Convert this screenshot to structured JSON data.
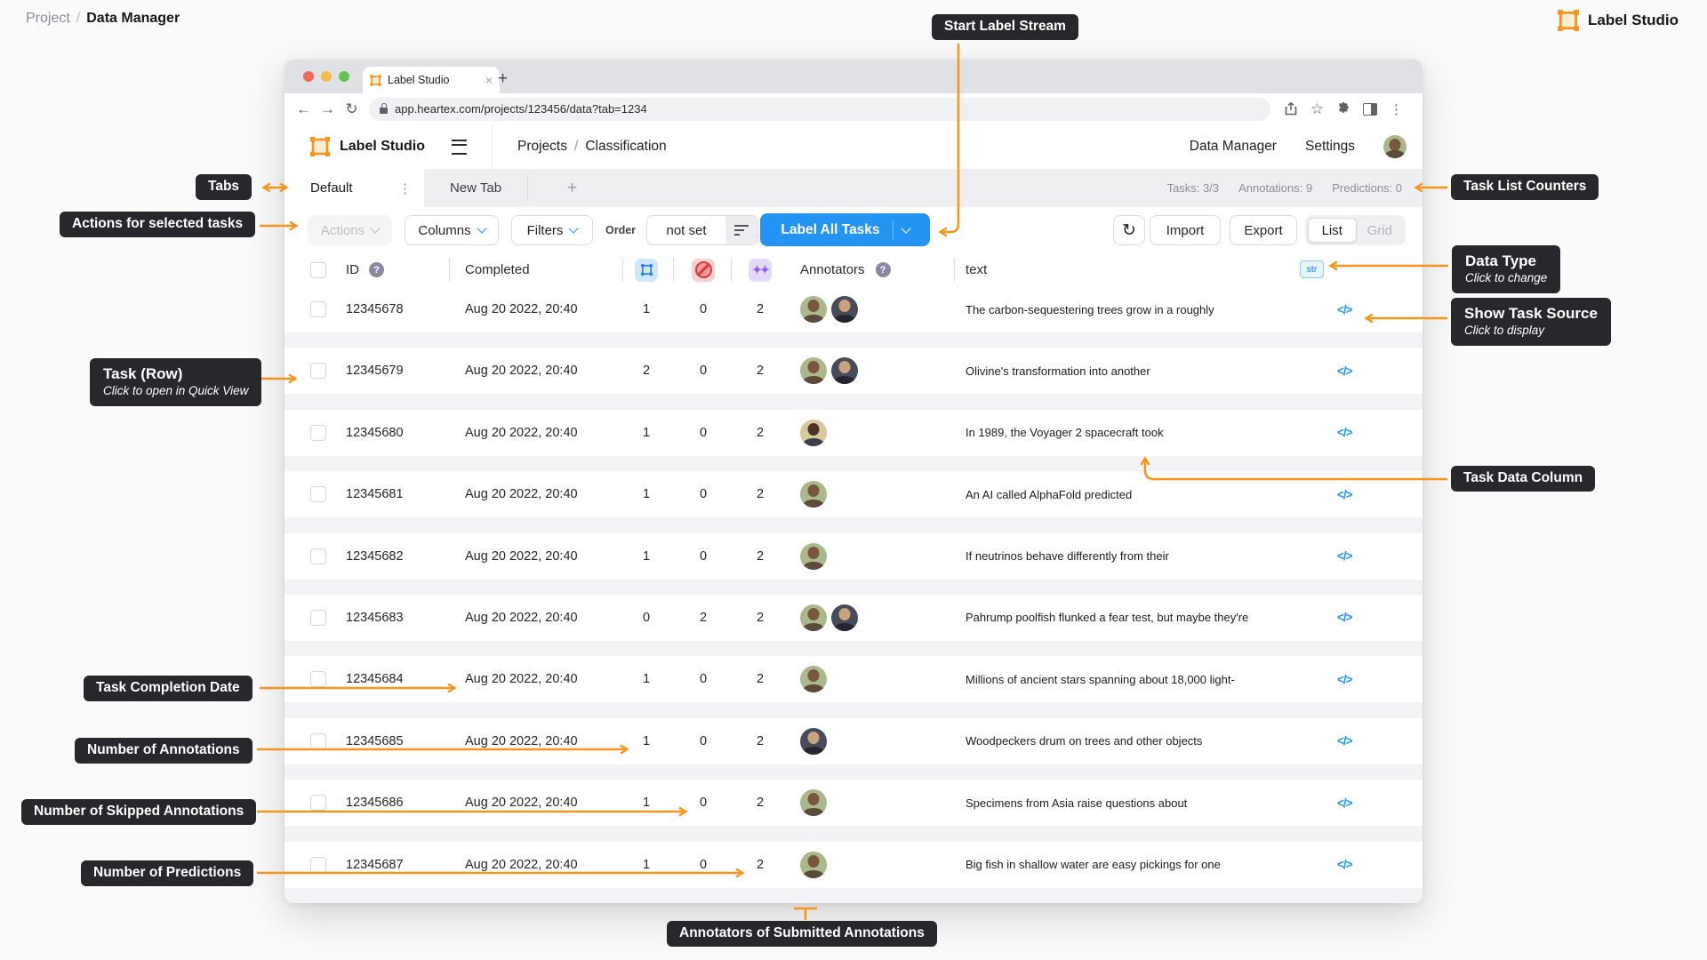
{
  "colors": {
    "accent_orange": "#F7941E",
    "primary_blue": "#2494F3",
    "link_blue": "#1890FF",
    "callout_bg": "#28282C"
  },
  "breadcrumb": {
    "project": "Project",
    "separator": "/",
    "current": "Data Manager"
  },
  "brand": {
    "name": "Label Studio"
  },
  "browser": {
    "tab_title": "Label Studio",
    "close_glyph": "×",
    "new_tab_glyph": "+",
    "back_glyph": "←",
    "forward_glyph": "→",
    "reload_glyph": "↻",
    "star_glyph": "☆",
    "kebab_glyph": "⋮",
    "url": "app.heartex.com/projects/123456/data?tab=1234"
  },
  "appheader": {
    "brand": "Label Studio",
    "nav_project": "Projects",
    "nav_sep": "/",
    "nav_page": "Classification",
    "link_data_manager": "Data Manager",
    "link_settings": "Settings"
  },
  "tabs": {
    "active_label": "Default",
    "kebab_glyph": "⋮",
    "inactive_label": "New Tab",
    "add_glyph": "+",
    "counters": [
      {
        "text": "Tasks: 3/3"
      },
      {
        "text": "Annotations: 9"
      },
      {
        "text": "Predictions: 0"
      }
    ]
  },
  "toolbar": {
    "actions_label": "Actions",
    "columns_label": "Columns",
    "filters_label": "Filters",
    "order_label": "Order",
    "order_value": "not set",
    "label_all_label": "Label All Tasks",
    "import_label": "Import",
    "export_label": "Export",
    "list_label": "List",
    "grid_label": "Grid"
  },
  "table": {
    "header": {
      "id": "ID",
      "help_glyph": "?",
      "completed": "Completed",
      "annotators": "Annotators",
      "text": "text",
      "data_type_badge": "str"
    },
    "icons": {
      "annotation_results": "bounding-box-icon",
      "skipped": "no-entry-icon",
      "predictions": "sparkles-icon",
      "show_source_glyph": "</>",
      "sparkles_glyph": "✦✦"
    },
    "rows": [
      {
        "id": "12345678",
        "completed": "Aug 20 2022, 20:40",
        "annotations": "1",
        "skipped": "0",
        "predictions": "2",
        "annotators": [
          "g",
          "d"
        ],
        "text": "The carbon-sequestering trees grow in a roughly"
      },
      {
        "id": "12345679",
        "completed": "Aug 20 2022, 20:40",
        "annotations": "2",
        "skipped": "0",
        "predictions": "2",
        "annotators": [
          "g",
          "d"
        ],
        "text": "Olivine's transformation into another"
      },
      {
        "id": "12345680",
        "completed": "Aug 20 2022, 20:40",
        "annotations": "1",
        "skipped": "0",
        "predictions": "2",
        "annotators": [
          "t"
        ],
        "text": "In 1989, the Voyager 2 spacecraft took"
      },
      {
        "id": "12345681",
        "completed": "Aug 20 2022, 20:40",
        "annotations": "1",
        "skipped": "0",
        "predictions": "2",
        "annotators": [
          "g"
        ],
        "text": "An AI called AlphaFold predicted"
      },
      {
        "id": "12345682",
        "completed": "Aug 20 2022, 20:40",
        "annotations": "1",
        "skipped": "0",
        "predictions": "2",
        "annotators": [
          "g"
        ],
        "text": "If neutrinos behave differently from their"
      },
      {
        "id": "12345683",
        "completed": "Aug 20 2022, 20:40",
        "annotations": "0",
        "skipped": "2",
        "predictions": "2",
        "annotators": [
          "g",
          "d"
        ],
        "text": "Pahrump poolfish flunked a fear test, but maybe they're"
      },
      {
        "id": "12345684",
        "completed": "Aug 20 2022, 20:40",
        "annotations": "1",
        "skipped": "0",
        "predictions": "2",
        "annotators": [
          "g"
        ],
        "text": "Millions of ancient stars spanning about 18,000 light-"
      },
      {
        "id": "12345685",
        "completed": "Aug 20 2022, 20:40",
        "annotations": "1",
        "skipped": "0",
        "predictions": "2",
        "annotators": [
          "d"
        ],
        "text": "Woodpeckers drum on trees and other objects"
      },
      {
        "id": "12345686",
        "completed": "Aug 20 2022, 20:40",
        "annotations": "1",
        "skipped": "0",
        "predictions": "2",
        "annotators": [
          "g"
        ],
        "text": "Specimens from Asia raise questions about"
      },
      {
        "id": "12345687",
        "completed": "Aug 20 2022, 20:40",
        "annotations": "1",
        "skipped": "0",
        "predictions": "2",
        "annotators": [
          "g"
        ],
        "text": "Big fish in shallow water are easy pickings for one"
      }
    ]
  },
  "callouts": {
    "start_label_stream": {
      "title": "Start Label Stream"
    },
    "tabs": {
      "title": "Tabs"
    },
    "actions": {
      "title": "Actions for selected tasks"
    },
    "task_row": {
      "title": "Task (Row)",
      "subtitle": "Click to open in Quick View"
    },
    "completion_date": {
      "title": "Task Completion Date"
    },
    "num_annotations": {
      "title": "Number of Annotations"
    },
    "num_skipped": {
      "title": "Number of Skipped Annotations"
    },
    "num_predictions": {
      "title": "Number of Predictions"
    },
    "task_list_counters": {
      "title": "Task List Counters"
    },
    "data_type": {
      "title": "Data Type",
      "subtitle": "Click to change"
    },
    "show_task_source": {
      "title": "Show Task Source",
      "subtitle": "Click to display"
    },
    "task_data_column": {
      "title": "Task Data Column"
    },
    "annotators_submitted": {
      "title": "Annotators of Submitted Annotations"
    }
  }
}
